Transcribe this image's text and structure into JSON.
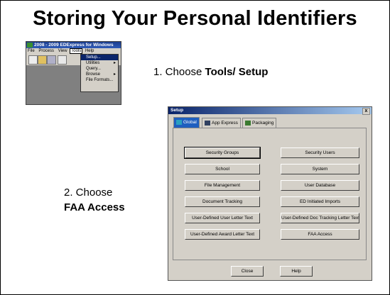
{
  "slide": {
    "title": "Storing Your Personal Identifiers",
    "step1_prefix": "1. Choose ",
    "step1_bold": "Tools/ Setup",
    "step2_prefix": "2. Choose",
    "step2_bold": "FAA Access"
  },
  "app_window": {
    "title": "2008 - 2009 EDExpress for Windows",
    "menu": [
      "File",
      "Process",
      "View",
      "Tools",
      "Help"
    ],
    "active_menu": "Tools",
    "tools_menu": [
      {
        "label": "Setup...",
        "highlighted": true,
        "submenu": false
      },
      {
        "label": "Utilities",
        "highlighted": false,
        "submenu": true
      },
      {
        "label": "Query...",
        "highlighted": false,
        "submenu": false
      },
      {
        "label": "Browse",
        "highlighted": false,
        "submenu": true
      },
      {
        "label": "File Formats...",
        "highlighted": false,
        "submenu": false
      }
    ]
  },
  "setup_dialog": {
    "title": "Setup",
    "close_glyph": "x",
    "tabs": [
      "Global",
      "App Express",
      "Packaging"
    ],
    "selected_tab": "Global",
    "buttons_left": [
      "Security Groups",
      "School",
      "File Management",
      "Document Tracking",
      "User-Defined User Letter Text",
      "User-Defined Award Letter Text"
    ],
    "buttons_right": [
      "Security Users",
      "System",
      "User Database",
      "ED Initiated Imports",
      "User-Defined Doc Tracking Letter Text",
      "FAA Access"
    ],
    "close_label": "Close",
    "help_label": "Help"
  },
  "colors": {
    "selected_tab": "#1f5fbf",
    "menu_highlight": "#0a246a",
    "dialog_face": "#d4d0c8"
  }
}
